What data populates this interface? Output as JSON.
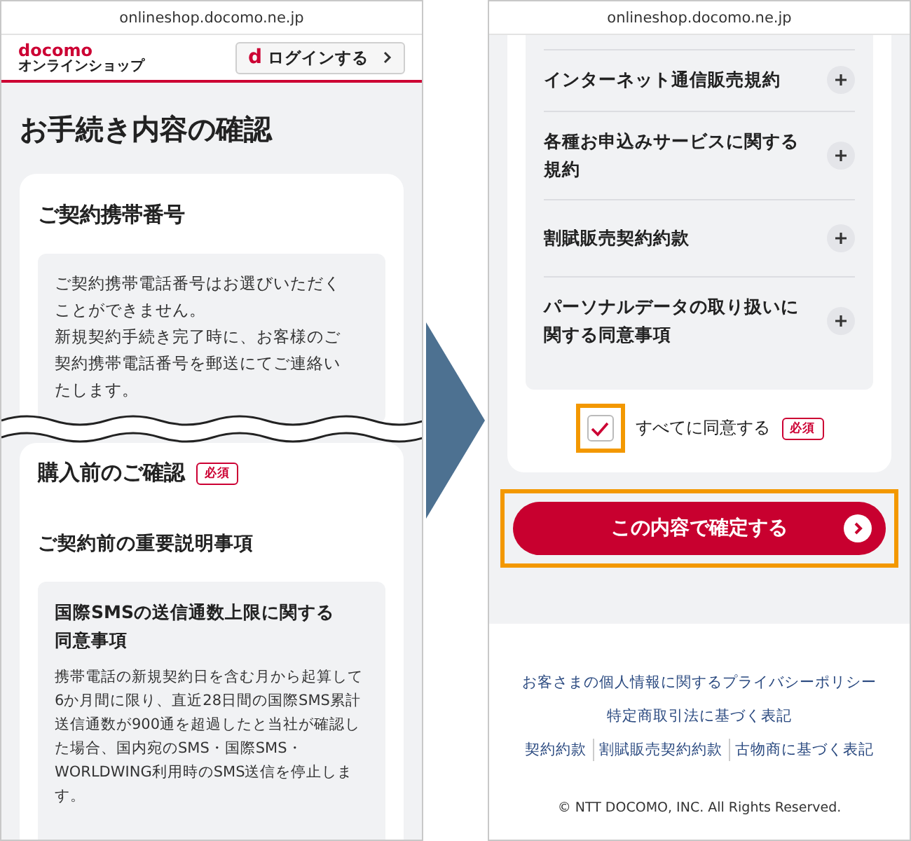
{
  "left_screen": {
    "url": "onlineshop.docomo.ne.jp",
    "logo": {
      "brand": "docomo",
      "subtitle": "オンラインショップ"
    },
    "login_button": {
      "mark": "d",
      "label": "ログインする"
    },
    "page_title": "お手続き内容の確認",
    "phone_number_card": {
      "heading": "ご契約携帯番号",
      "notice": [
        "ご契約携帯電話番号はお選びいただくことができません。",
        "新規契約手続き完了時に、お客様のご契約携帯電話番号を郵送にてご連絡いたします。"
      ]
    },
    "confirmation_card": {
      "heading": "購入前のご確認",
      "badge": "必須",
      "subheading": "ご契約前の重要説明事項",
      "item": {
        "title": "国際SMSの送信通数上限に関する同意事項",
        "body": "携帯電話の新規契約日を含む月から起算して6か月間に限り、直近28日間の国際SMS累計送信通数が900通を超過したと当社が確認した場合、国内宛のSMS・国際SMS・WORLDWING利用時のSMS送信を停止します。"
      }
    }
  },
  "right_screen": {
    "url": "onlineshop.docomo.ne.jp",
    "terms": [
      {
        "title": "インターネット通信販売規約",
        "expanded": false
      },
      {
        "title": "各種お申込みサービスに関する規約",
        "expanded": false
      },
      {
        "title": "割賦販売契約約款",
        "expanded": false
      },
      {
        "title": "パーソナルデータの取り扱いに関する同意事項",
        "expanded": false
      }
    ],
    "agreement": {
      "label": "すべてに同意する",
      "badge": "必須",
      "checked": true,
      "highlighted": true
    },
    "confirm_button": {
      "label": "この内容で確定する",
      "highlighted": true
    },
    "footer": {
      "links": [
        [
          "お客さまの個人情報に関するプライバシーポリシー"
        ],
        [
          "特定商取引法に基づく表記"
        ],
        [
          "契約約款",
          "割賦販売契約約款",
          "古物商に基づく表記"
        ]
      ],
      "copyright": "© NTT DOCOMO, INC. All Rights Reserved."
    }
  }
}
